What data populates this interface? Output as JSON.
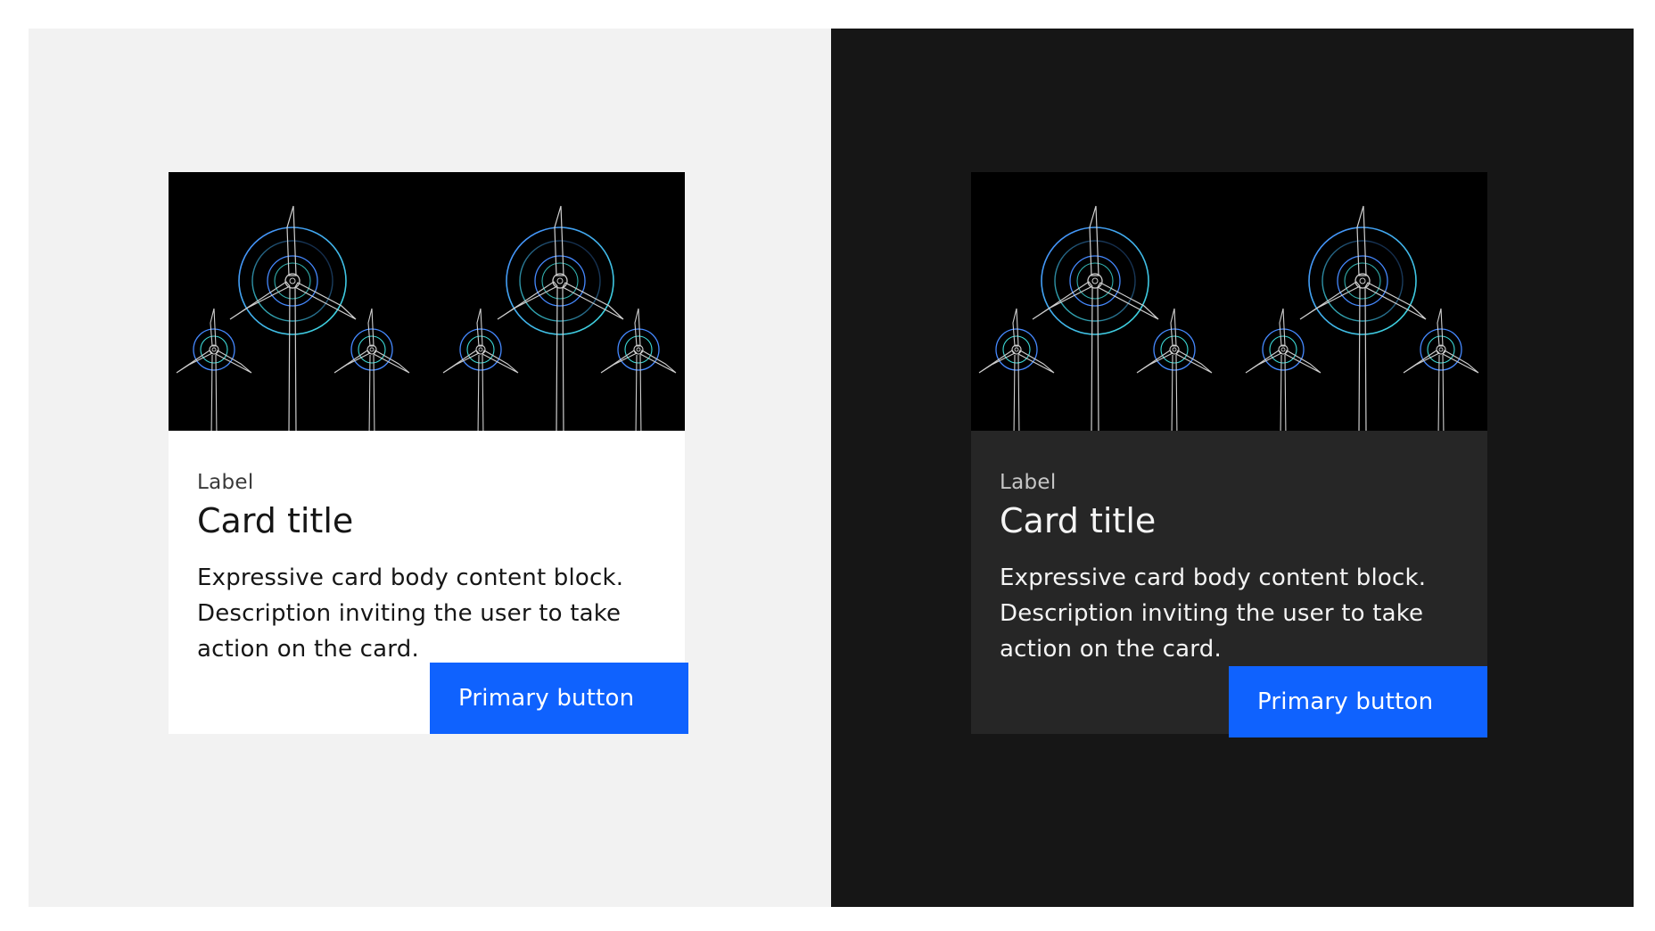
{
  "cards": {
    "light": {
      "label": "Label",
      "title": "Card title",
      "description": "Expressive card body content block. Description inviting the user to take action on the card.",
      "button_label": "Primary button"
    },
    "dark": {
      "label": "Label",
      "title": "Card title",
      "description": "Expressive card body content block. Description inviting the user to take action on the card.",
      "button_label": "Primary button"
    }
  },
  "colors": {
    "light_panel_bg": "#f2f2f2",
    "dark_panel_bg": "#161616",
    "light_card_bg": "#ffffff",
    "dark_card_bg": "#262626",
    "media_bg": "#000000",
    "primary_button": "#0f62fe",
    "turbine_line": "#cfcfcf",
    "ring_blue": "#4589ff",
    "ring_teal": "#3ddbd9"
  },
  "media": {
    "icon": "wind-turbines-illustration"
  }
}
